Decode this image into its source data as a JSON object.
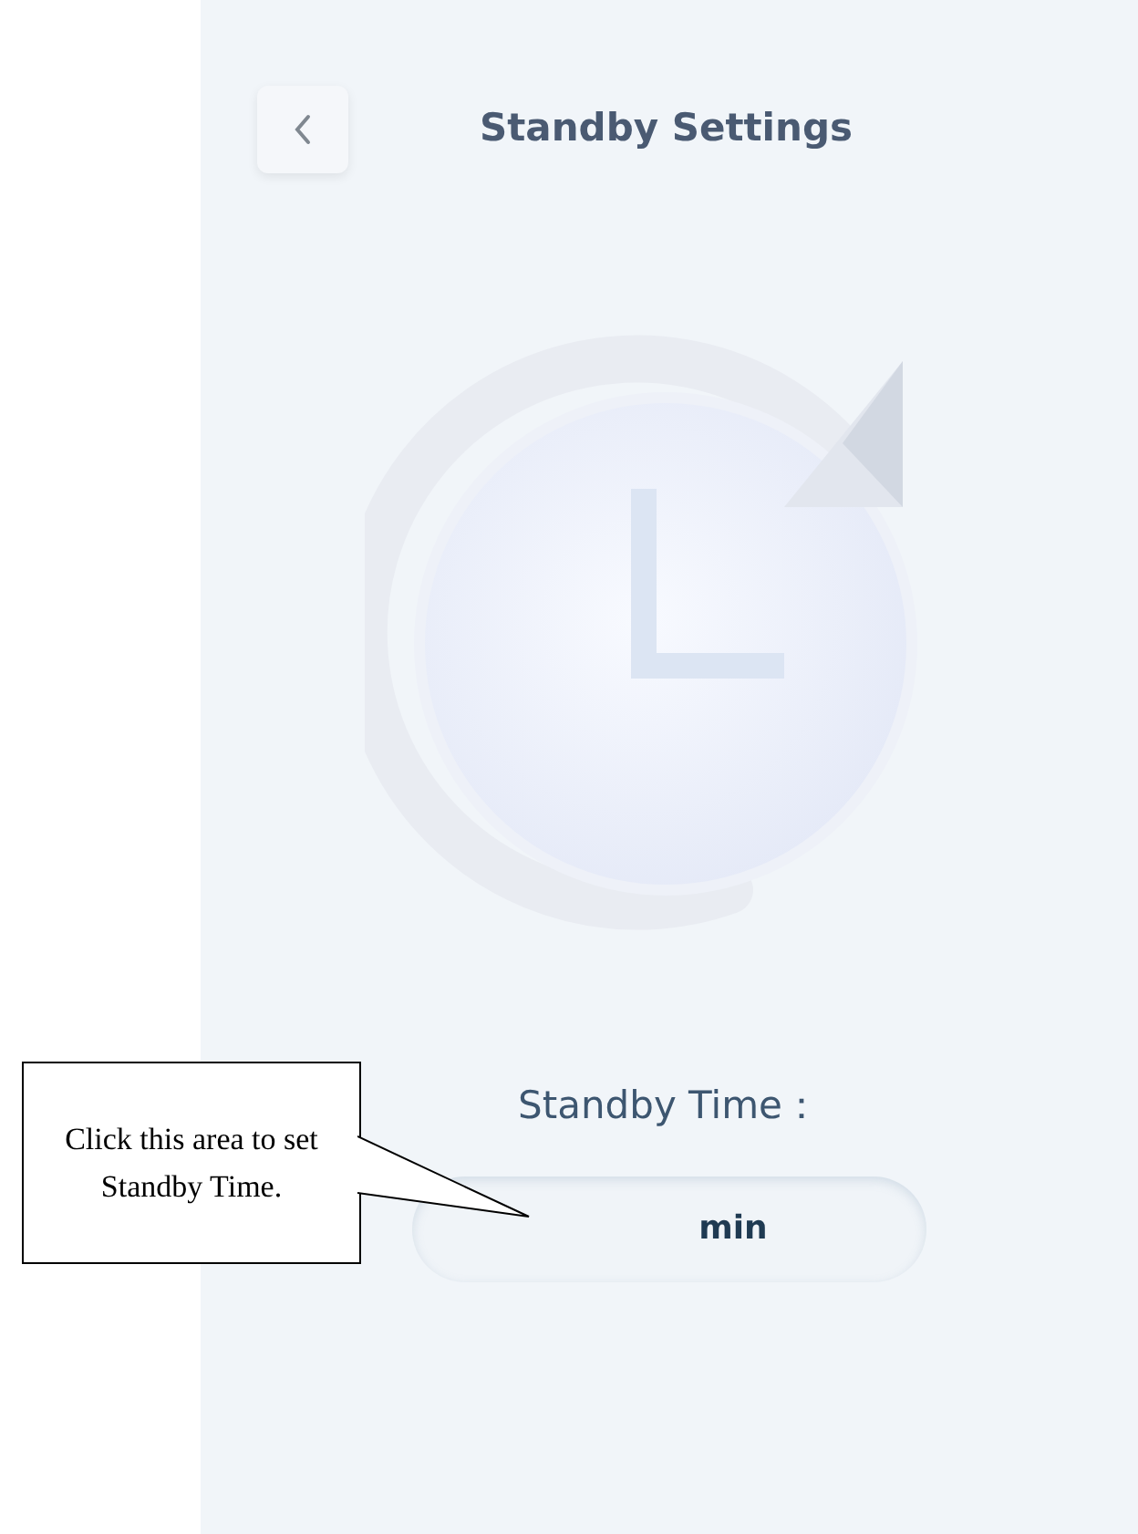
{
  "header": {
    "title": "Standby Settings"
  },
  "standby": {
    "label": "Standby Time：",
    "unit": "min"
  },
  "callout": {
    "text": "Click this area to set Standby Time."
  }
}
